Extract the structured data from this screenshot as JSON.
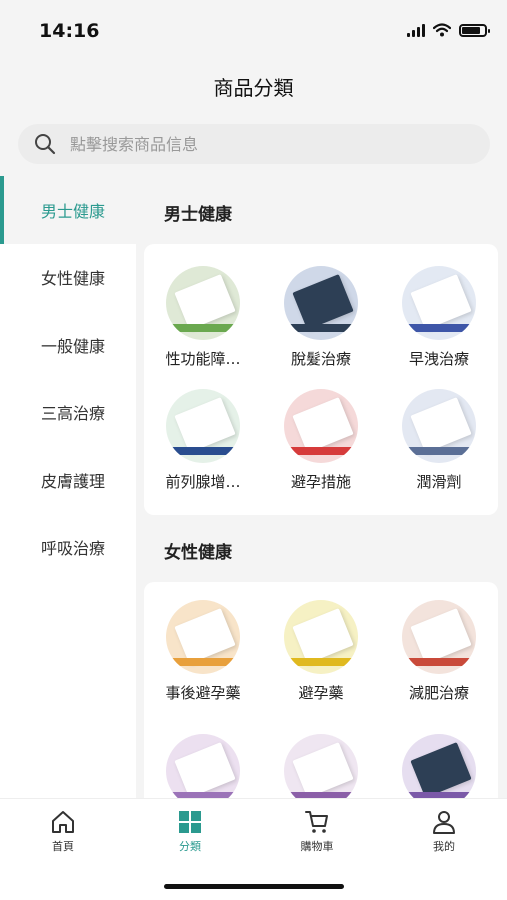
{
  "status_bar": {
    "time": "14:16"
  },
  "header": {
    "title": "商品分類"
  },
  "search": {
    "placeholder": "點擊搜索商品信息"
  },
  "sidebar": {
    "items": [
      {
        "label": "男士健康",
        "active": true
      },
      {
        "label": "女性健康"
      },
      {
        "label": "一般健康"
      },
      {
        "label": "三高治療"
      },
      {
        "label": "皮膚護理"
      },
      {
        "label": "呼吸治療"
      }
    ]
  },
  "sections": [
    {
      "title": "男士健康",
      "items": [
        {
          "label": "性功能障…",
          "color": "#dfe9d6",
          "accent": "#6aa84f"
        },
        {
          "label": "脫髮治療",
          "color": "#cfd8e8",
          "accent": "#2d3f55"
        },
        {
          "label": "早洩治療",
          "color": "#e3e9f3",
          "accent": "#3e56a8"
        },
        {
          "label": "前列腺增…",
          "color": "#e5f1e8",
          "accent": "#2a4d8f"
        },
        {
          "label": "避孕措施",
          "color": "#f5d9d9",
          "accent": "#d63b3b"
        },
        {
          "label": "潤滑劑",
          "color": "#e3e8f2",
          "accent": "#5b6f96"
        }
      ]
    },
    {
      "title": "女性健康",
      "items": [
        {
          "label": "事後避孕藥",
          "color": "#f8e4c9",
          "accent": "#e8a03c"
        },
        {
          "label": "避孕藥",
          "color": "#f6f1c4",
          "accent": "#e0b91f"
        },
        {
          "label": "減肥治療",
          "color": "#f3e3dc",
          "accent": "#c94a3a"
        },
        {
          "label": "",
          "color": "#ece0f0",
          "accent": "#9b73b8"
        },
        {
          "label": "",
          "color": "#efe6f1",
          "accent": "#8b5fa8"
        },
        {
          "label": "",
          "color": "#e6def0",
          "accent": "#7b59a8"
        }
      ]
    }
  ],
  "tabbar": {
    "tabs": [
      {
        "label": "首頁",
        "icon": "home-icon"
      },
      {
        "label": "分類",
        "icon": "category-icon",
        "active": true
      },
      {
        "label": "購物車",
        "icon": "cart-icon"
      },
      {
        "label": "我的",
        "icon": "profile-icon"
      }
    ]
  },
  "colors": {
    "accent": "#2b9a8f"
  }
}
